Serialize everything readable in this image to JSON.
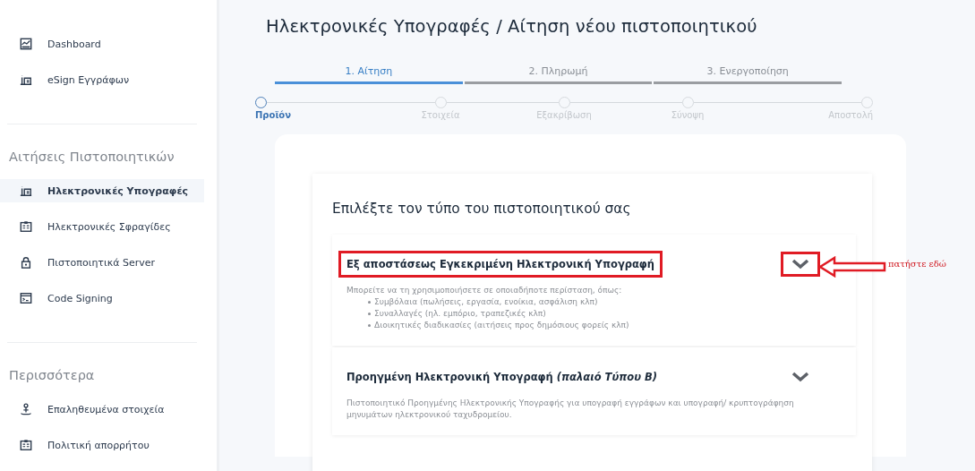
{
  "sidebar": {
    "top_items": [
      {
        "label": "Dashboard",
        "kind": "chart",
        "selected": false
      },
      {
        "label": "eSign Εγγράφων",
        "kind": "sign",
        "selected": false
      }
    ],
    "sections": [
      {
        "title": "Αιτήσεις Πιστοποιητικών",
        "items": [
          {
            "label": "Ηλεκτρονικές Υπογραφές",
            "kind": "sign",
            "selected": true
          },
          {
            "label": "Ηλεκτρονικές Σφραγίδες",
            "kind": "card",
            "selected": false
          },
          {
            "label": "Πιστοποιητικά Server",
            "kind": "lock",
            "selected": false
          },
          {
            "label": "Code Signing",
            "kind": "terminal",
            "selected": false
          }
        ]
      },
      {
        "title": "Περισσότερα",
        "items": [
          {
            "label": "Επαληθευμένα στοιχεία",
            "kind": "person",
            "selected": false
          },
          {
            "label": "Πολιτική απορρήτου",
            "kind": "card",
            "selected": false
          }
        ]
      }
    ]
  },
  "page_title": "Ηλεκτρονικές Υπογραφές / Αίτηση νέου πιστοποιητικού",
  "phases": [
    {
      "label": "1. Αίτηση",
      "selected": true
    },
    {
      "label": "2. Πληρωμή",
      "selected": false
    },
    {
      "label": "3. Ενεργοποίηση",
      "selected": false
    }
  ],
  "steps": [
    {
      "label": "Προϊόν",
      "selected": true
    },
    {
      "label": "Στοιχεία",
      "selected": false
    },
    {
      "label": "Εξακρίβωση",
      "selected": false
    },
    {
      "label": "Σύνοψη",
      "selected": false
    },
    {
      "label": "Αποστολή",
      "selected": false
    }
  ],
  "card": {
    "heading": "Επιλέξτε τον τύπο του πιστοποιητικού σας",
    "options": [
      {
        "title": "Εξ αποστάσεως Εγκεκριμένη Ηλεκτρονική Υπογραφή",
        "highlighted": true,
        "description": "Μπορείτε να τη χρησιμοποιήσετε σε οποιαδήποτε περίσταση, όπως:",
        "bullets": [
          "Συμβόλαια (πωλήσεις, εργασία, ενοίκια, ασφάλιση κλπ)",
          "Συναλλαγές (ηλ. εμπόριο, τραπεζικές κλπ)",
          "Διοικητικές διαδικασίες (αιτήσεις προς δημόσιους φορείς κλπ)"
        ]
      },
      {
        "title": "Προηγμένη Ηλεκτρονική Υπογραφή *(παλαιό Τύπου B)*",
        "highlighted": false,
        "description": "Πιστοποιητικό Προηγμένης Ηλεκτρονικής Υπογραφής για υπογραφή εγγράφων και υπογραφή/ κρυπτογράφηση μηνυμάτων ηλεκτρονικού ταχυδρομείου."
      }
    ]
  },
  "annotation": {
    "text": "πατήστε εδώ"
  }
}
